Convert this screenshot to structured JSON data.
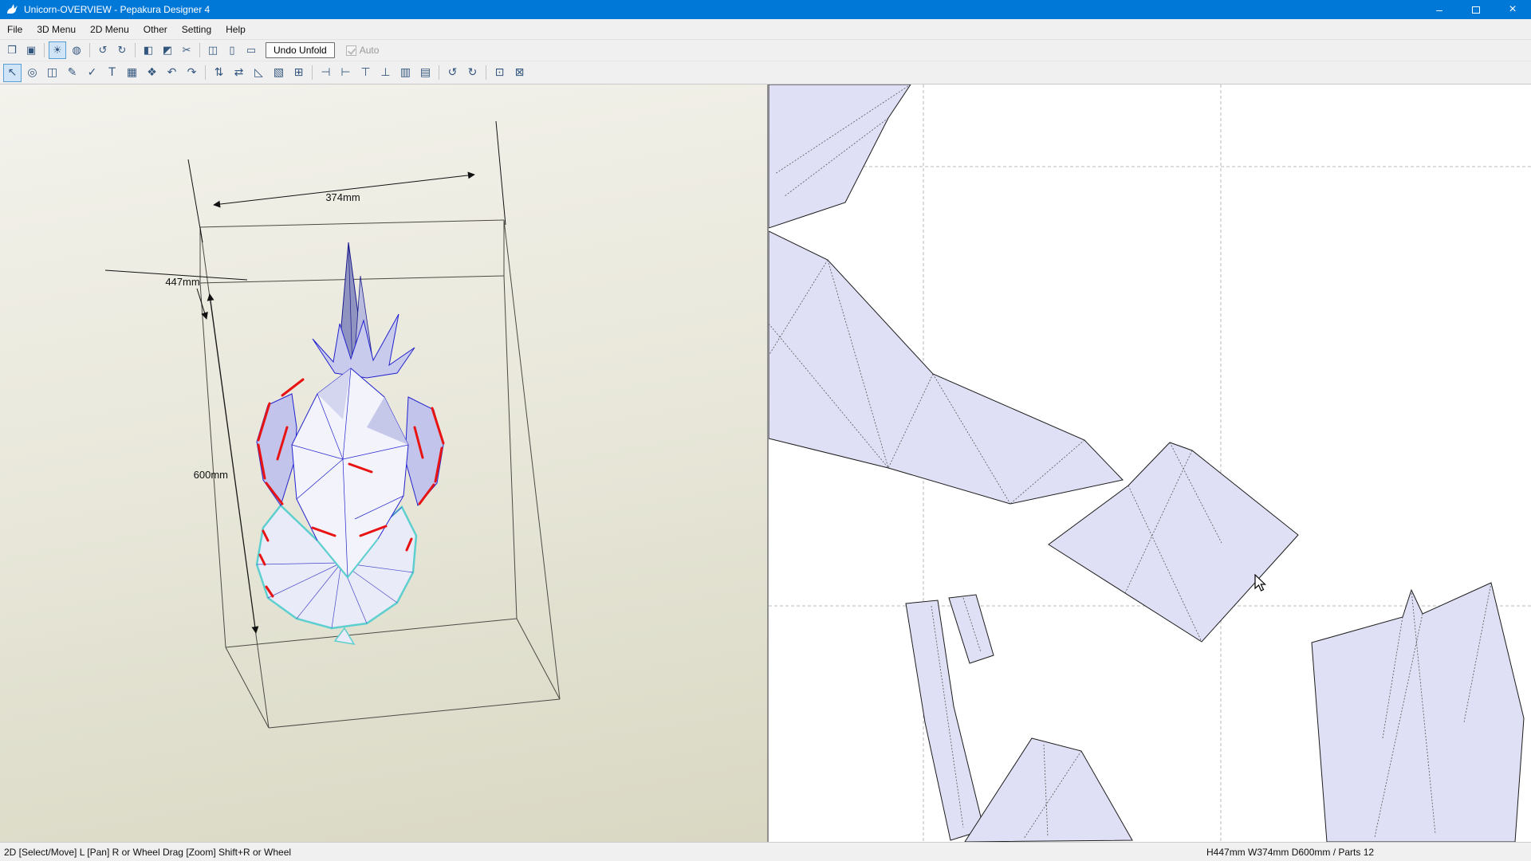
{
  "window": {
    "title": "Unicorn-OVERVIEW - Pepakura Designer 4",
    "controls": {
      "minimize": "–",
      "close": "×"
    }
  },
  "menubar": {
    "items": [
      {
        "label": "File"
      },
      {
        "label": "3D Menu"
      },
      {
        "label": "2D Menu"
      },
      {
        "label": "Other"
      },
      {
        "label": "Setting"
      },
      {
        "label": "Help"
      }
    ]
  },
  "toolbar_main": {
    "buttons": [
      {
        "name": "open-folder-icon",
        "glyph": "❒"
      },
      {
        "name": "save-icon",
        "glyph": "▣"
      },
      {
        "sep": true
      },
      {
        "name": "light-icon",
        "glyph": "☀",
        "pressed": true
      },
      {
        "name": "texture-icon",
        "glyph": "◍"
      },
      {
        "sep": true
      },
      {
        "name": "rotate-left-icon",
        "glyph": "↺"
      },
      {
        "name": "rotate-right-icon",
        "glyph": "↻"
      },
      {
        "sep": true
      },
      {
        "name": "shade-view-icon",
        "glyph": "◧"
      },
      {
        "name": "edge-view-icon",
        "glyph": "◩"
      },
      {
        "name": "unfold-icon",
        "glyph": "✂"
      },
      {
        "sep": true
      },
      {
        "name": "split-window-icon",
        "glyph": "◫"
      },
      {
        "name": "3d-window-icon",
        "glyph": "▯"
      },
      {
        "name": "2d-window-icon",
        "glyph": "▭"
      }
    ],
    "undo_unfold_label": "Undo Unfold",
    "auto_label": "Auto"
  },
  "toolbar_2d": {
    "buttons": [
      {
        "name": "select-move-icon",
        "glyph": "↖",
        "pressed": true
      },
      {
        "name": "rotate-part-icon",
        "glyph": "◎"
      },
      {
        "name": "divide-join-icon",
        "glyph": "◫"
      },
      {
        "name": "edit-line-icon",
        "glyph": "✎"
      },
      {
        "name": "check-line-icon",
        "glyph": "✓"
      },
      {
        "name": "text-tool-icon",
        "glyph": "T"
      },
      {
        "name": "image-tool-icon",
        "glyph": "▦"
      },
      {
        "name": "symbol-tool-icon",
        "glyph": "❖"
      },
      {
        "name": "undo-icon",
        "glyph": "↶"
      },
      {
        "name": "redo-icon",
        "glyph": "↷"
      },
      {
        "sep": true
      },
      {
        "name": "reverse-fold-icon",
        "glyph": "⇅"
      },
      {
        "name": "swap-flap-icon",
        "glyph": "⇄"
      },
      {
        "name": "add-flap-icon",
        "glyph": "◺"
      },
      {
        "name": "sheet-icon",
        "glyph": "▧"
      },
      {
        "name": "arrange-parts-icon",
        "glyph": "⊞"
      },
      {
        "sep": true
      },
      {
        "name": "align-left-icon",
        "glyph": "⊣"
      },
      {
        "name": "align-right-icon",
        "glyph": "⊢"
      },
      {
        "name": "align-top-icon",
        "glyph": "⊤"
      },
      {
        "name": "align-bottom-icon",
        "glyph": "⊥"
      },
      {
        "name": "center-h-icon",
        "glyph": "▥"
      },
      {
        "name": "center-v-icon",
        "glyph": "▤"
      },
      {
        "sep": true
      },
      {
        "name": "rotate-left-part-icon",
        "glyph": "↺"
      },
      {
        "name": "rotate-right-part-icon",
        "glyph": "↻"
      },
      {
        "sep": true
      },
      {
        "name": "select-all-parts-icon",
        "glyph": "⊡"
      },
      {
        "name": "fit-view-icon",
        "glyph": "⊠"
      }
    ]
  },
  "viewport_3d": {
    "dims": {
      "width": "374mm",
      "height": "447mm",
      "depth": "600mm"
    }
  },
  "statusbar": {
    "left": "2D [Select/Move] L [Pan] R or Wheel Drag [Zoom] Shift+R or Wheel",
    "right": "H447mm W374mm D600mm / Parts 12"
  },
  "colors": {
    "titlebar": "#0078d7",
    "edge_blue": "#2323cf",
    "fold_red": "#e81313",
    "open_edge_cyan": "#5ecfcf",
    "part_fill": "#dfe0f5"
  }
}
